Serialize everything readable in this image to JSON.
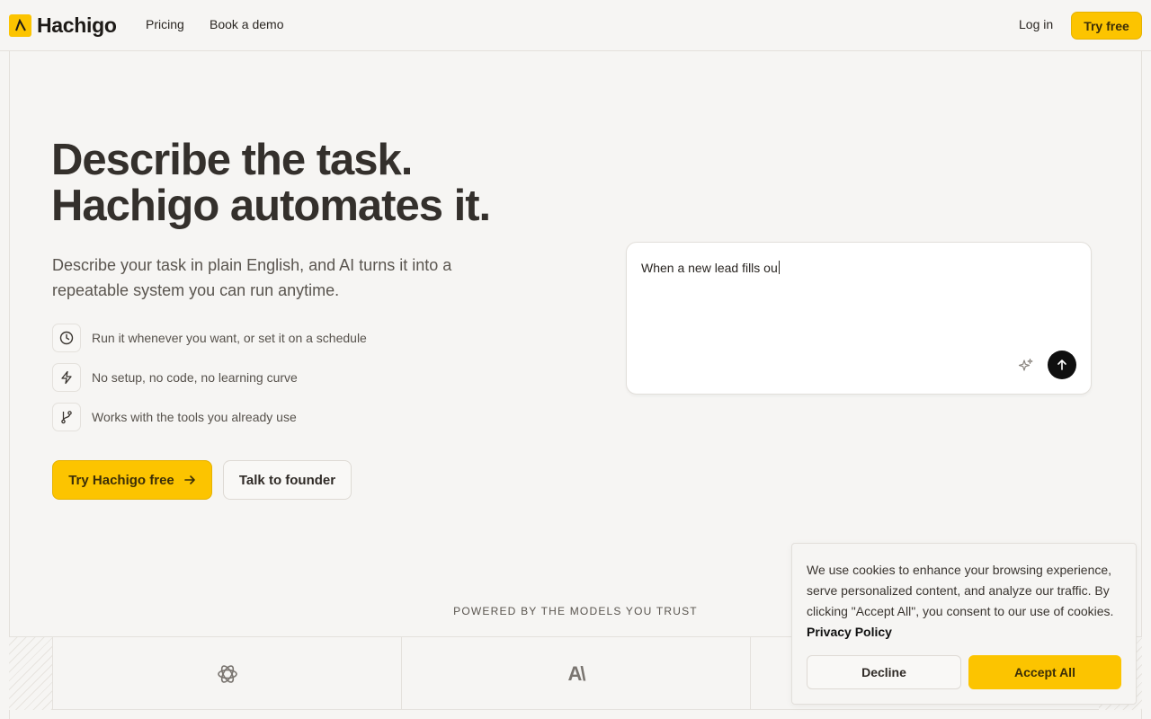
{
  "header": {
    "brand": "Hachigo",
    "nav": [
      "Pricing",
      "Book a demo"
    ],
    "login_label": "Log in",
    "try_free_label": "Try free"
  },
  "hero": {
    "title_line1": "Describe the task.",
    "title_line2": "Hachigo automates it.",
    "subtitle": "Describe your task in plain English, and AI turns it into a repeatable system you can run anytime.",
    "features": [
      {
        "icon": "clock-icon",
        "text": "Run it whenever you want, or set it on a schedule"
      },
      {
        "icon": "lightning-icon",
        "text": "No setup, no code, no learning curve"
      },
      {
        "icon": "git-branch-icon",
        "text": "Works with the tools you already use"
      }
    ],
    "cta_primary": "Try Hachigo free",
    "cta_secondary": "Talk to founder"
  },
  "prompt": {
    "value": "When a new lead fills ou"
  },
  "powered_by": {
    "label": "POWERED BY THE MODELS YOU TRUST",
    "models": [
      "openai-logo-icon",
      "anthropic-logo-icon"
    ],
    "anthropic_glyph": "A\\"
  },
  "cookie": {
    "text": "We use cookies to enhance your browsing experience, serve personalized content, and analyze our traffic. By clicking \"Accept All\", you consent to our use of cookies.",
    "link_label": "Privacy Policy",
    "decline_label": "Decline",
    "accept_label": "Accept All"
  },
  "colors": {
    "accent": "#fcc400",
    "background": "#f6f5f3",
    "text": "#34302c"
  }
}
